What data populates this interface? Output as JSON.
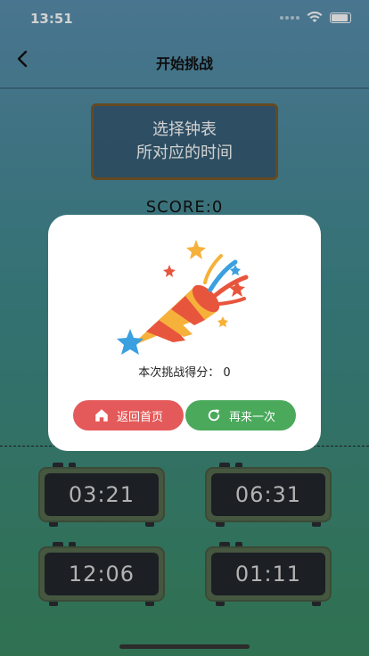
{
  "status_bar": {
    "time": "13:51"
  },
  "nav": {
    "title": "开始挑战"
  },
  "question": {
    "line1": "选择钟表",
    "line2": "所对应的时间"
  },
  "score": {
    "label": "SCORE:0"
  },
  "clocks": [
    {
      "time": "03:21"
    },
    {
      "time": "06:31"
    },
    {
      "time": "12:06"
    },
    {
      "time": "01:11"
    }
  ],
  "modal": {
    "result_text": "本次挑战得分：  0",
    "home_button": "返回首页",
    "retry_button": "再来一次",
    "icons": {
      "celebration": "party-popper-icon",
      "home": "home-icon",
      "retry": "refresh-icon"
    },
    "colors": {
      "home": "#e45a5a",
      "retry": "#4aa95b"
    }
  }
}
